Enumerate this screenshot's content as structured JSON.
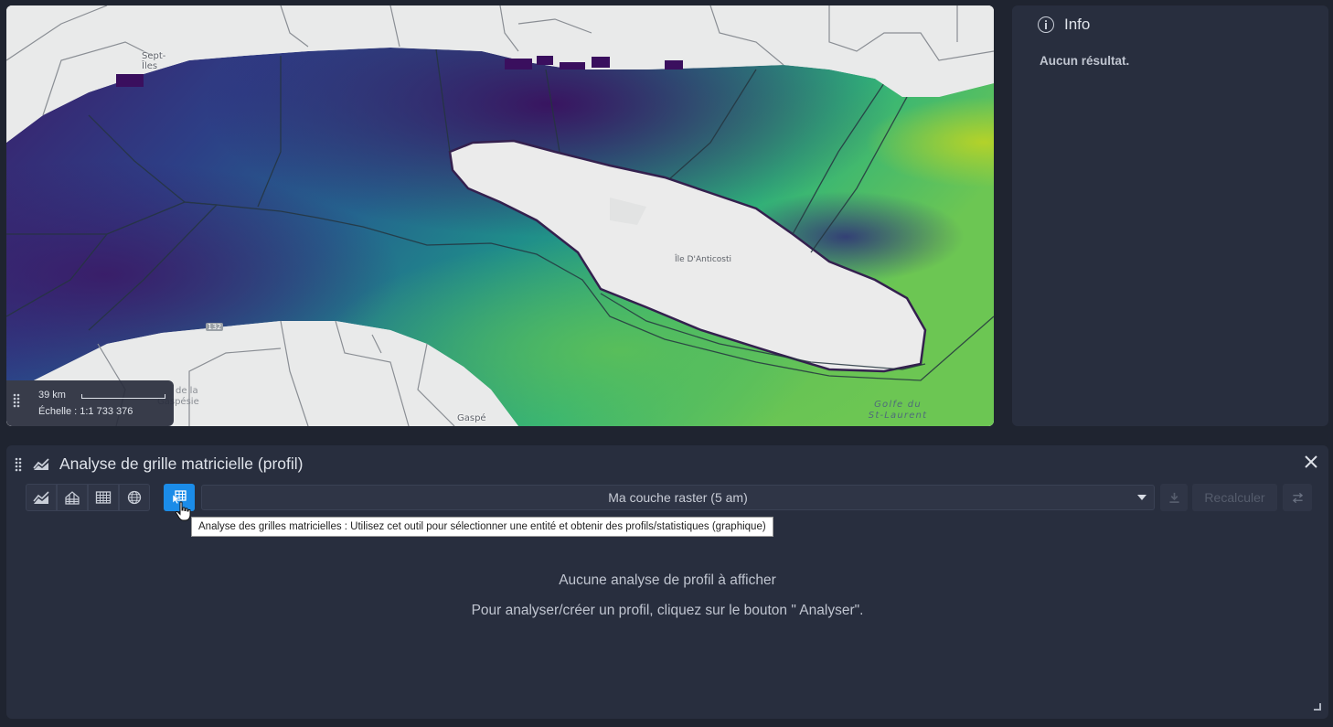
{
  "map": {
    "labels": {
      "city1": "Sept-",
      "city1b": "Îles",
      "island": "Île D'Anticosti",
      "gulf1": "Golfe du",
      "gulf2": "St-Laurent",
      "gaspe": "Gaspé",
      "reserve1": "de la",
      "reserve2": "Gaspésie",
      "route": "132"
    },
    "scale": {
      "distance": "39 km",
      "ratio": "Échelle : 1:1 733 376"
    }
  },
  "info": {
    "title": "Info",
    "result": "Aucun résultat."
  },
  "panel": {
    "title": "Analyse de grille matricielle (profil)",
    "tools": [
      "profile-chart-icon",
      "area-chart-icon",
      "table-icon",
      "globe-icon"
    ],
    "layer": "Ma couche raster (5 am)",
    "recalc": "Recalculer",
    "tooltip": "Analyse des grilles matricielles : Utilisez cet outil pour sélectionner une entité et obtenir des profils/statistiques (graphique)",
    "empty_title": "Aucune analyse de profil à afficher",
    "empty_hint": "Pour analyser/créer un profil, cliquez sur le bouton \" Analyser\"."
  },
  "colors": {
    "accent": "#1b8ce8",
    "panel": "#282e3e",
    "background": "#1f2430"
  }
}
